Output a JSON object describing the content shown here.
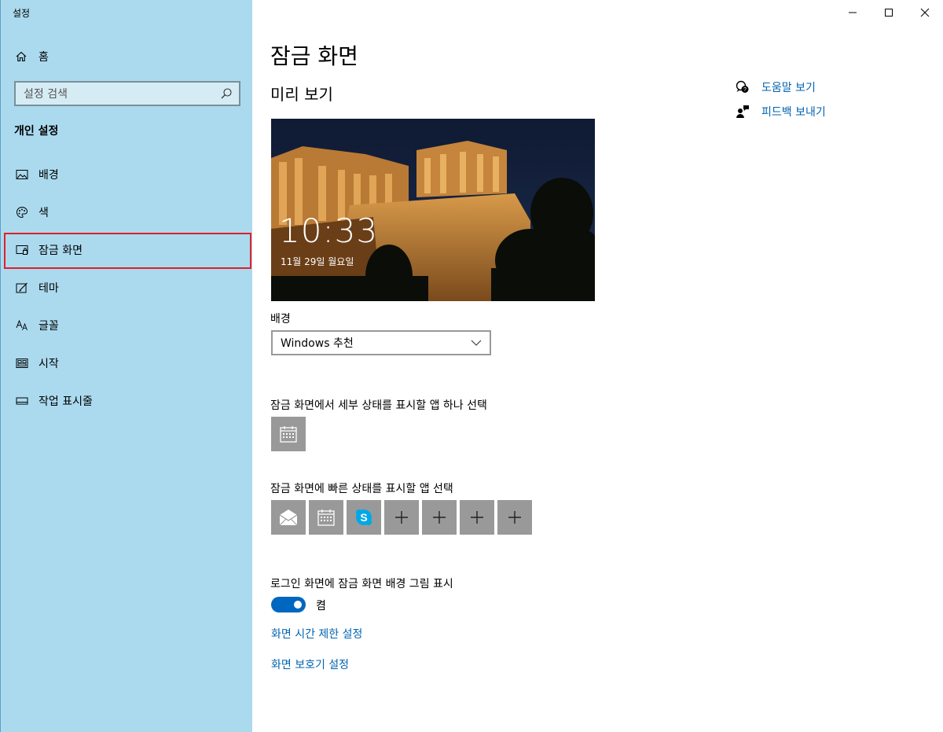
{
  "window": {
    "title": "설정",
    "controls": [
      "minimize",
      "maximize",
      "close"
    ]
  },
  "sidebar": {
    "home_label": "홈",
    "search_placeholder": "설정 검색",
    "section_title": "개인 설정",
    "items": [
      {
        "label": "배경",
        "icon": "picture-icon"
      },
      {
        "label": "색",
        "icon": "palette-icon"
      },
      {
        "label": "잠금 화면",
        "icon": "lock-screen-icon",
        "selected": true
      },
      {
        "label": "테마",
        "icon": "theme-icon"
      },
      {
        "label": "글꼴",
        "icon": "font-icon"
      },
      {
        "label": "시작",
        "icon": "start-icon"
      },
      {
        "label": "작업 표시줄",
        "icon": "taskbar-icon"
      }
    ]
  },
  "main": {
    "title": "잠금 화면",
    "preview_title": "미리 보기",
    "preview_time": "10:33",
    "preview_date": "11월 29일 월요일",
    "background_label": "배경",
    "background_value": "Windows 추천",
    "detail_app_label": "잠금 화면에서 세부 상태를 표시할 앱 하나 선택",
    "quick_apps_label": "잠금 화면에 빠른 상태를 표시할 앱 선택",
    "quick_apps": [
      "mail-icon",
      "calendar-icon",
      "skype-icon",
      "plus-icon",
      "plus-icon",
      "plus-icon",
      "plus-icon"
    ],
    "login_bg_label": "로그인 화면에 잠금 화면 배경 그림 표시",
    "login_bg_state": "켬",
    "login_bg_on": true,
    "timeout_link": "화면 시간 제한 설정",
    "screensaver_link": "화면 보호기 설정"
  },
  "related": {
    "help_label": "도움말 보기",
    "feedback_label": "피드백 보내기"
  },
  "colors": {
    "sidebar_bg": "#abdaef",
    "accent": "#0067c0",
    "link": "#0063b1",
    "tile_bg": "#999999",
    "selection_outline": "#e0202a"
  }
}
